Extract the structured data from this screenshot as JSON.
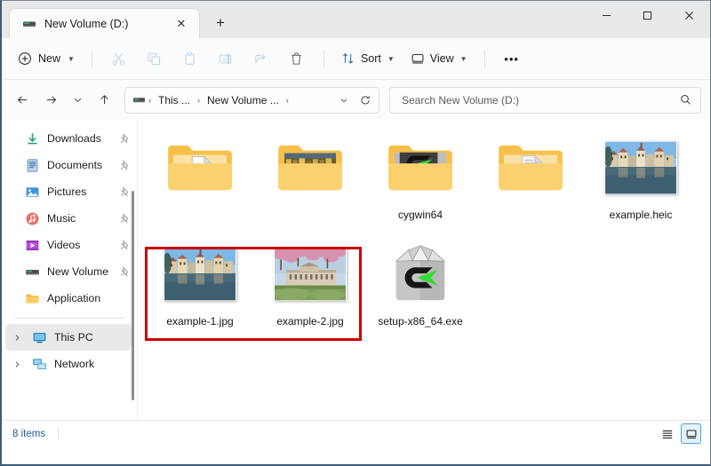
{
  "window": {
    "controls": {
      "minimize": "minimize-icon",
      "maximize": "maximize-icon",
      "close": "close-icon"
    }
  },
  "tabs": [
    {
      "title": "New Volume (D:)",
      "icon": "drive-icon",
      "active": true,
      "close_label": "✕"
    }
  ],
  "new_tab_label": "+",
  "toolbar": {
    "new_label": "New",
    "new_icon": "plus-circle-icon",
    "buttons": [
      {
        "name": "cut-button",
        "icon": "scissors-icon",
        "disabled": true
      },
      {
        "name": "copy-button",
        "icon": "copy-icon",
        "disabled": true
      },
      {
        "name": "paste-button",
        "icon": "clipboard-icon",
        "disabled": true
      },
      {
        "name": "rename-button",
        "icon": "rename-icon",
        "disabled": true
      },
      {
        "name": "share-button",
        "icon": "share-icon",
        "disabled": true
      },
      {
        "name": "delete-button",
        "icon": "trash-icon",
        "disabled": false
      }
    ],
    "sort_label": "Sort",
    "sort_icon": "sort-arrows-icon",
    "view_label": "View",
    "view_icon": "monitor-icon",
    "more_label": "•••"
  },
  "navigation": {
    "back_icon": "arrow-left-icon",
    "forward_icon": "arrow-right-icon",
    "recent_icon": "chevron-down-icon",
    "up_icon": "arrow-up-icon",
    "refresh_icon": "refresh-icon",
    "dropdown_icon": "chevron-down-icon"
  },
  "breadcrumb": {
    "drive_icon": "drive-icon",
    "items": [
      "This ...",
      "New Volume ..."
    ],
    "separator": "›"
  },
  "search": {
    "placeholder": "Search New Volume (D:)",
    "value": "",
    "icon": "search-icon"
  },
  "sidebar": {
    "items": [
      {
        "label": "Downloads",
        "icon": "downloads-icon",
        "pinned": true,
        "chevron": false,
        "selected": false
      },
      {
        "label": "Documents",
        "icon": "documents-icon",
        "pinned": true,
        "chevron": false,
        "selected": false
      },
      {
        "label": "Pictures",
        "icon": "pictures-icon",
        "pinned": true,
        "chevron": false,
        "selected": false
      },
      {
        "label": "Music",
        "icon": "music-icon",
        "pinned": true,
        "chevron": false,
        "selected": false
      },
      {
        "label": "Videos",
        "icon": "videos-icon",
        "pinned": true,
        "chevron": false,
        "selected": false
      },
      {
        "label": "New Volume",
        "icon": "drive-icon",
        "pinned": true,
        "chevron": false,
        "selected": false
      },
      {
        "label": "Application",
        "icon": "folder-icon",
        "pinned": false,
        "chevron": false,
        "selected": false
      }
    ],
    "tree": [
      {
        "label": "This PC",
        "icon": "this-pc-icon",
        "chevron": true,
        "selected": true
      },
      {
        "label": "Network",
        "icon": "network-icon",
        "chevron": true,
        "selected": false
      }
    ],
    "pin_icon": "pin-icon",
    "expand_icon": "chevron-right-icon"
  },
  "files": {
    "row1": [
      {
        "label": "",
        "type": "folder-with-document-thumb",
        "name": "folder-item"
      },
      {
        "label": "",
        "type": "folder-with-photo-thumb",
        "name": "folder-item"
      },
      {
        "label": "cygwin64",
        "type": "folder-with-cygwin-thumb",
        "name": "folder-item"
      },
      {
        "label": "",
        "type": "folder-with-text-thumb",
        "name": "folder-item"
      },
      {
        "label": "example.heic",
        "type": "image-thumb-town",
        "name": "file-item"
      }
    ],
    "row2": [
      {
        "label": "example-1.jpg",
        "type": "image-thumb-town",
        "name": "file-item",
        "highlighted": true
      },
      {
        "label": "example-2.jpg",
        "type": "image-thumb-palace",
        "name": "file-item",
        "highlighted": true
      },
      {
        "label": "setup-x86_64.exe",
        "type": "cygwin-setup-icon",
        "name": "file-item"
      }
    ]
  },
  "annotation": {
    "color": "#cc0000"
  },
  "statusbar": {
    "item_count": "8 items",
    "list_view_icon": "list-view-icon",
    "details_view_icon": "large-icons-view-icon",
    "active_view": "large-icons-view-icon"
  }
}
